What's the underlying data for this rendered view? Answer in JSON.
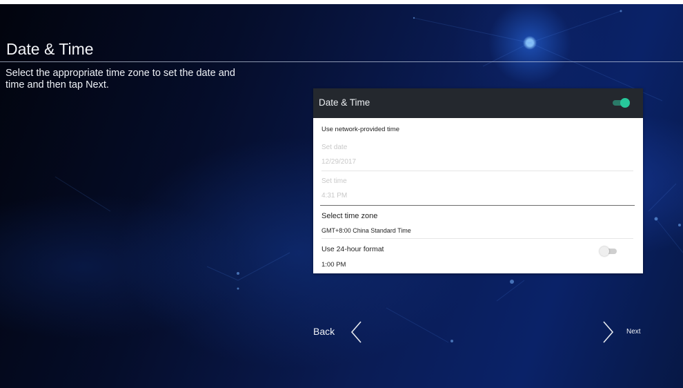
{
  "page": {
    "title": "Date & Time",
    "description": "Select the appropriate time zone to set the date and time and then tap Next."
  },
  "panel": {
    "title": "Date & Time",
    "master_toggle": "on",
    "network_time_label": "Use network-provided time",
    "set_date_label": "Set date",
    "set_date_value": "12/29/2017",
    "set_time_label": "Set time",
    "set_time_value": "4:31 PM",
    "time_zone_label": "Select time zone",
    "time_zone_value": "GMT+8:00 China Standard Time",
    "hour_format_label": "Use 24-hour format",
    "hour_format_toggle": "off",
    "time_example": "1:00 PM"
  },
  "nav": {
    "back_label": "Back",
    "next_label": "Next"
  },
  "colors": {
    "toggle_on": "#27c79b",
    "panel_header": "#24282e",
    "background": "#0a1c55"
  },
  "icons": {
    "back": "chevron-left-icon",
    "next": "chevron-right-icon"
  }
}
